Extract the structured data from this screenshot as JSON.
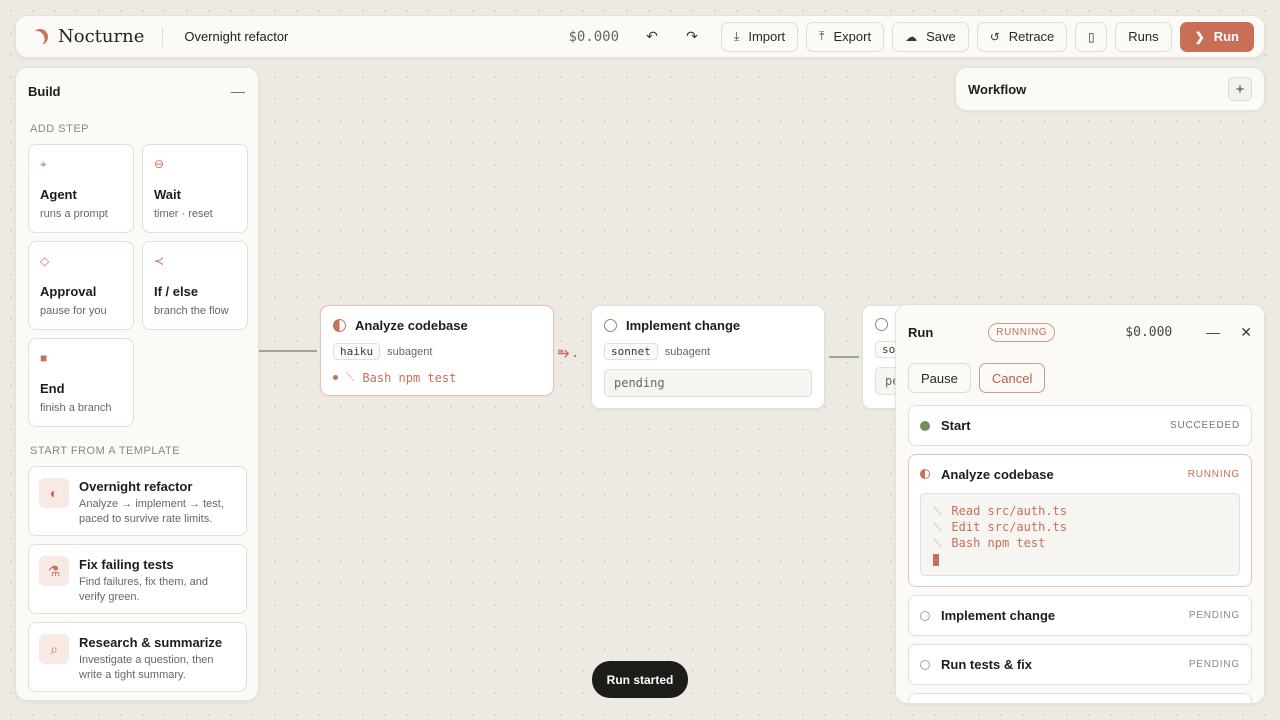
{
  "app": {
    "name": "Nocturne",
    "project_title": "Overnight refactor"
  },
  "topbar": {
    "cost": "$0.000",
    "undo_icon": "undo-icon",
    "redo_icon": "redo-icon",
    "import_label": "Import",
    "export_label": "Export",
    "save_label": "Save",
    "retrace_label": "Retrace",
    "runs_label": "Runs",
    "run_label": "Run"
  },
  "build": {
    "title": "Build",
    "add_step_label": "ADD STEP",
    "steps": [
      {
        "icon": "agent-icon",
        "name": "Agent",
        "desc": "runs a prompt"
      },
      {
        "icon": "wait-icon",
        "name": "Wait",
        "desc": "timer · reset"
      },
      {
        "icon": "approval-icon",
        "name": "Approval",
        "desc": "pause for you"
      },
      {
        "icon": "branch-icon",
        "name": "If / else",
        "desc": "branch the flow"
      },
      {
        "icon": "end-icon",
        "name": "End",
        "desc": "finish a branch"
      }
    ],
    "template_label": "START FROM A TEMPLATE",
    "templates": [
      {
        "icon": "half-moon-icon",
        "name": "Overnight refactor",
        "desc": "Analyze → implement → test, paced to survive rate limits."
      },
      {
        "icon": "flask-icon",
        "name": "Fix failing tests",
        "desc": "Find failures, fix them, and verify green."
      },
      {
        "icon": "search-icon",
        "name": "Research & summarize",
        "desc": "Investigate a question, then write a tight summary."
      }
    ]
  },
  "workflow": {
    "title": "Workflow"
  },
  "canvas": {
    "nodes": [
      {
        "title": "Analyze codebase",
        "model": "haiku",
        "kind": "subagent",
        "log": "Bash npm test",
        "status": "running"
      },
      {
        "title": "Implement change",
        "model": "sonnet",
        "kind": "subagent",
        "log": "pending",
        "status": "pending"
      },
      {
        "title": "",
        "model": "so",
        "kind": "",
        "log": "pe",
        "status": "pending"
      }
    ]
  },
  "run": {
    "title": "Run",
    "status": "RUNNING",
    "cost": "$0.000",
    "pause_label": "Pause",
    "cancel_label": "Cancel",
    "steps": [
      {
        "name": "Start",
        "status": "SUCCEEDED"
      },
      {
        "name": "Analyze codebase",
        "status": "RUNNING",
        "log": [
          "Read src/auth.ts",
          "Edit src/auth.ts",
          "Bash npm test"
        ]
      },
      {
        "name": "Implement change",
        "status": "PENDING"
      },
      {
        "name": "Run tests & fix",
        "status": "PENDING"
      }
    ]
  },
  "toast": {
    "message": "Run started"
  },
  "colors": {
    "accent": "#c96f58",
    "success": "#6d8f62",
    "background": "#edeae3"
  }
}
